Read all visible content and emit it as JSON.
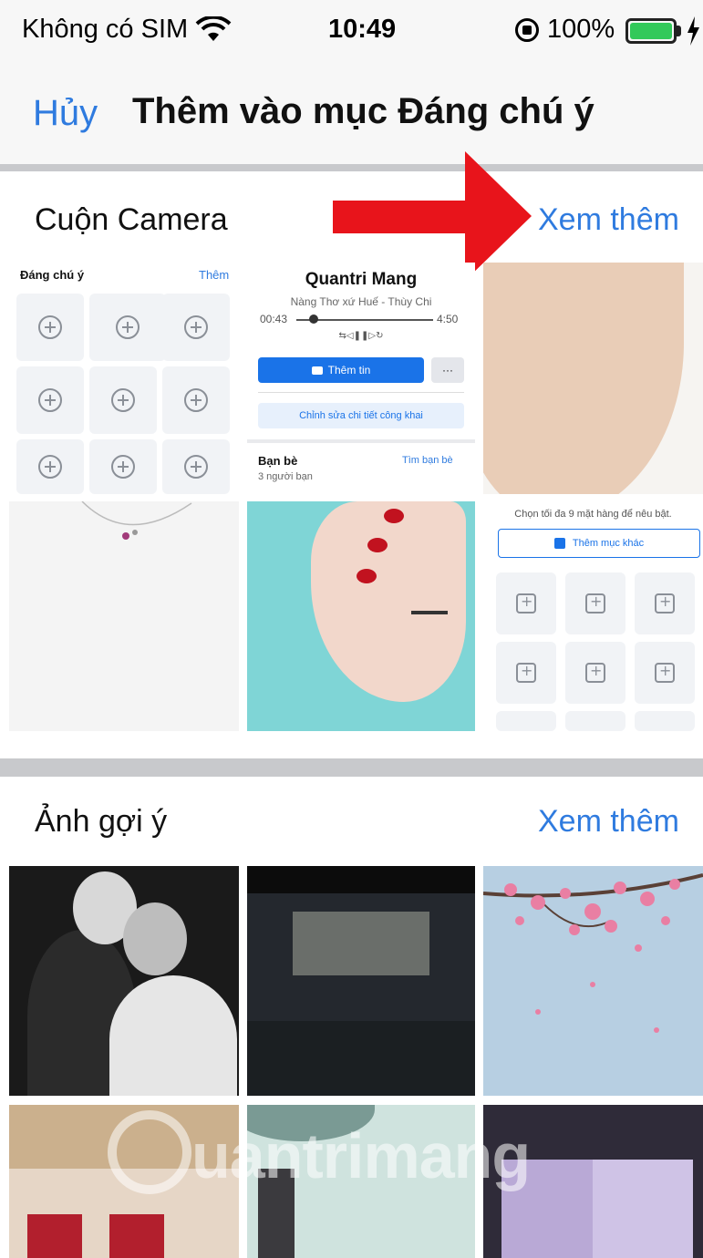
{
  "status_bar": {
    "carrier": "Không có SIM",
    "time": "10:49",
    "battery": "100%"
  },
  "nav": {
    "cancel_label": "Hủy",
    "title": "Thêm vào mục Đáng chú ý"
  },
  "camera_roll": {
    "title": "Cuộn Camera",
    "see_more": "Xem thêm",
    "thumb1": {
      "heading": "Đáng chú ý",
      "action": "Thêm"
    },
    "thumb2": {
      "profile_name": "Quantri Mang",
      "song": "Nàng Thơ xứ Huế - Thùy Chi",
      "time_elapsed": "00:43",
      "time_total": "4:50",
      "controls": "⇆◁❚❚▷↻",
      "add_story_button": "Thêm tin",
      "more_button": "···",
      "edit_public_button": "Chỉnh sửa chi tiết công khai",
      "friends_label": "Bạn bè",
      "find_friends": "Tìm bạn bè",
      "friend_count": "3 người bạn"
    },
    "thumb6": {
      "hint": "Chọn tối đa 9 mặt hàng để nêu bật.",
      "add_other_button": "Thêm mục khác"
    }
  },
  "suggested": {
    "title": "Ảnh gợi ý",
    "see_more": "Xem thêm"
  },
  "watermark": "uantrimang",
  "colors": {
    "accent": "#2f7bdf",
    "arrow": "#e8141b",
    "separator": "#c8c9cc"
  }
}
